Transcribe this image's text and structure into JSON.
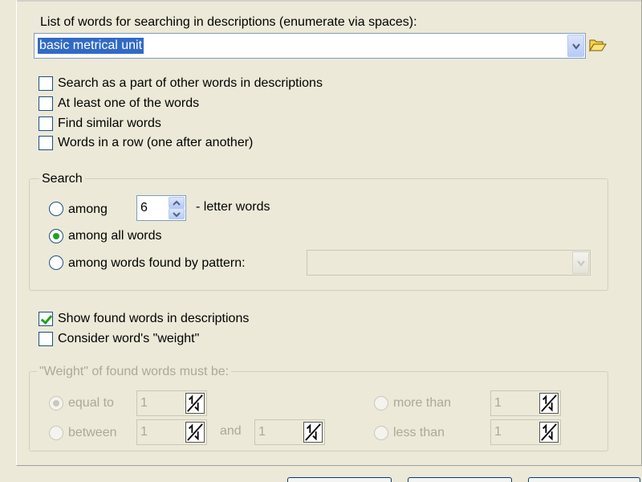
{
  "words": {
    "label": "List of words for searching in descriptions (enumerate via spaces):",
    "value": "basic metrical unit"
  },
  "options": [
    {
      "label": "Search as a part of other words in descriptions",
      "checked": false
    },
    {
      "label": "At least one of the words",
      "checked": false
    },
    {
      "label": "Find similar words",
      "checked": false
    },
    {
      "label": "Words in a row (one after another)",
      "checked": false
    }
  ],
  "search": {
    "title": "Search",
    "among_label": "among",
    "letters_value": "6",
    "letters_suffix": "- letter words",
    "all_label": "among all words",
    "pattern_label": "among words found by pattern:",
    "selected": "among all words"
  },
  "show_found": {
    "label": "Show found words in descriptions",
    "checked": true
  },
  "consider_weight": {
    "label": "Consider word's \"weight\"",
    "checked": false
  },
  "weight": {
    "title": "\"Weight\" of found words must be:",
    "equal_label": "equal to",
    "equal_value": "1",
    "between_label": "between",
    "between_value": "1",
    "and_label": "and",
    "and_value": "1",
    "more_label": "more than",
    "more_value": "1",
    "less_label": "less than",
    "less_value": "1",
    "selected": "equal to"
  }
}
